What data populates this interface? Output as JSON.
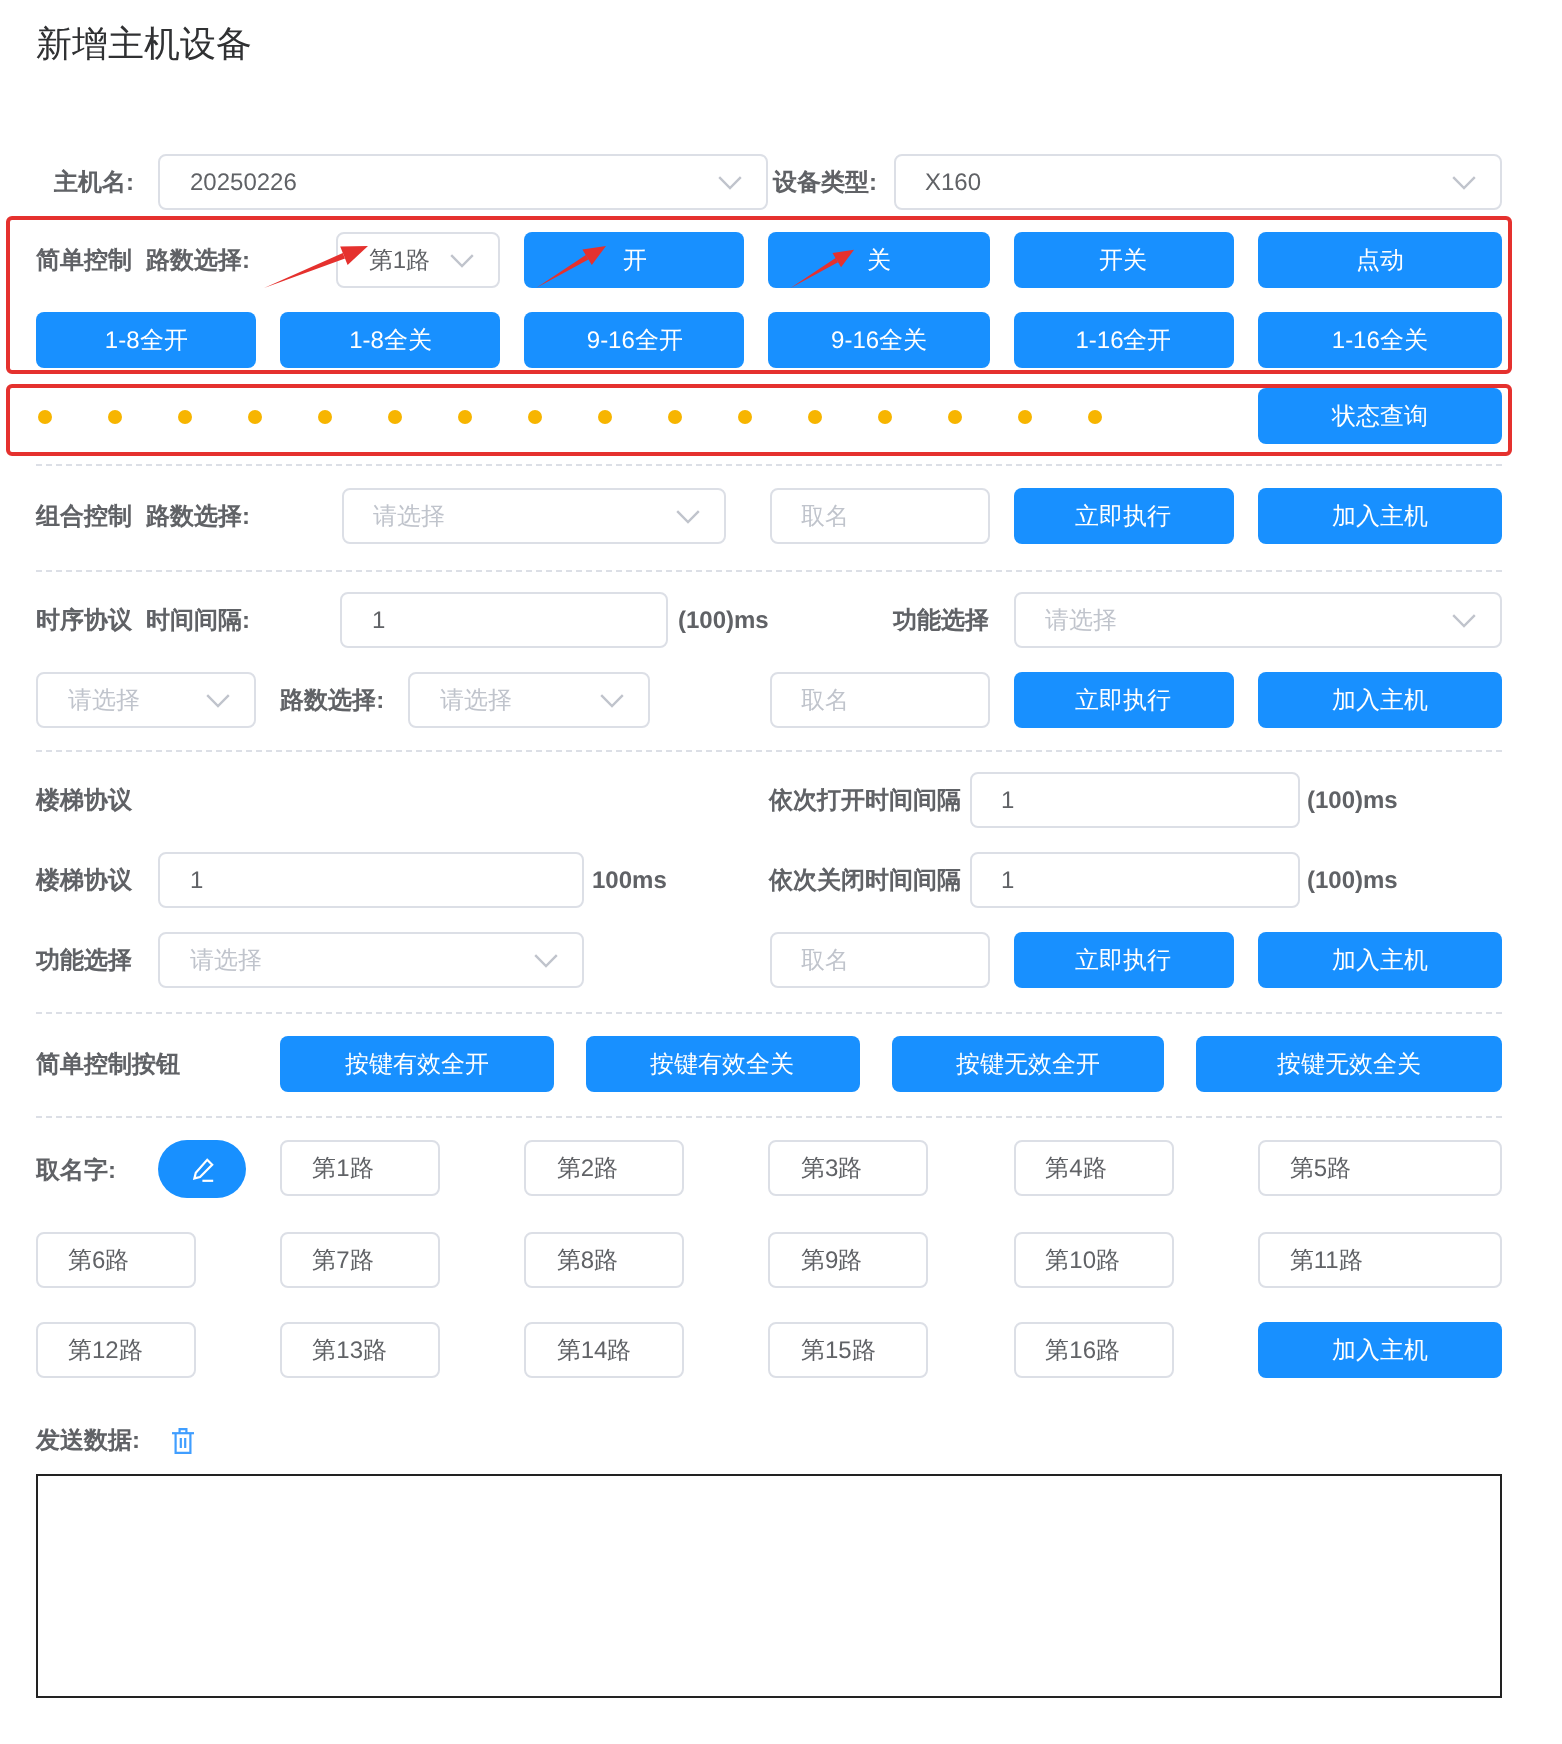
{
  "title": "新增主机设备",
  "host": {
    "name": {
      "label": "主机名:",
      "value": "20250226"
    },
    "type": {
      "label": "设备类型:",
      "value": "X160"
    }
  },
  "simple_control": {
    "label": "简单控制",
    "channel_label": "路数选择:",
    "channel_select": {
      "value": "第1路"
    },
    "buttons": [
      "开",
      "关",
      "开关",
      "点动"
    ],
    "range_buttons": [
      "1-8全开",
      "1-8全关",
      "9-16全开",
      "9-16全关",
      "1-16全开",
      "1-16全关"
    ]
  },
  "status": {
    "lights": [
      {
        "color": "#f7b500"
      },
      {
        "color": "#f7b500"
      },
      {
        "color": "#f7b500"
      },
      {
        "color": "#f7b500"
      },
      {
        "color": "#f7b500"
      },
      {
        "color": "#f7b500"
      },
      {
        "color": "#f7b500"
      },
      {
        "color": "#f7b500"
      },
      {
        "color": "#f7b500"
      },
      {
        "color": "#f7b500"
      },
      {
        "color": "#f7b500"
      },
      {
        "color": "#f7b500"
      },
      {
        "color": "#f7b500"
      },
      {
        "color": "#f7b500"
      },
      {
        "color": "#f7b500"
      },
      {
        "color": "#f7b500"
      }
    ],
    "query_button": "状态查询"
  },
  "group_control": {
    "label": "组合控制",
    "channel_label": "路数选择:",
    "channel_select": {
      "placeholder": "请选择"
    },
    "name_field": {
      "placeholder": "取名"
    },
    "buttons": [
      "立即执行",
      "加入主机"
    ]
  },
  "timing_protocol": {
    "label": "时序协议",
    "interval_label": "时间间隔:",
    "interval_field": {
      "value": "1"
    },
    "interval_unit": "(100)ms",
    "function_label": "功能选择",
    "function_select": {
      "placeholder": "请选择"
    },
    "mode_select": {
      "placeholder": "请选择"
    },
    "channel_label": "路数选择:",
    "channel_select": {
      "placeholder": "请选择"
    },
    "name_field": {
      "placeholder": "取名"
    },
    "buttons": [
      "立即执行",
      "加入主机"
    ]
  },
  "stair_protocol": {
    "label": "楼梯协议",
    "open_interval": {
      "label": "依次打开时间间隔",
      "value": "1",
      "unit": "(100)ms"
    },
    "stair": {
      "label": "楼梯协议",
      "value": "1",
      "unit": "100ms"
    },
    "close_interval": {
      "label": "依次关闭时间间隔",
      "value": "1",
      "unit": "(100)ms"
    },
    "function_label": "功能选择",
    "function_select": {
      "placeholder": "请选择"
    },
    "name_field": {
      "placeholder": "取名"
    },
    "buttons": [
      "立即执行",
      "加入主机"
    ]
  },
  "key_control": {
    "label": "简单控制按钮",
    "buttons": [
      "按键有效全开",
      "按键有效全关",
      "按键无效全开",
      "按键无效全关"
    ]
  },
  "naming": {
    "label": "取名字:",
    "fields": [
      {
        "value": "第1路"
      },
      {
        "value": "第2路"
      },
      {
        "value": "第3路"
      },
      {
        "value": "第4路"
      },
      {
        "value": "第5路"
      },
      {
        "value": "第6路"
      },
      {
        "value": "第7路"
      },
      {
        "value": "第8路"
      },
      {
        "value": "第9路"
      },
      {
        "value": "第10路"
      },
      {
        "value": "第11路"
      },
      {
        "value": "第12路"
      },
      {
        "value": "第13路"
      },
      {
        "value": "第14路"
      },
      {
        "value": "第15路"
      },
      {
        "value": "第16路"
      }
    ],
    "add_button": "加入主机"
  },
  "send_data": {
    "label": "发送数据:"
  }
}
